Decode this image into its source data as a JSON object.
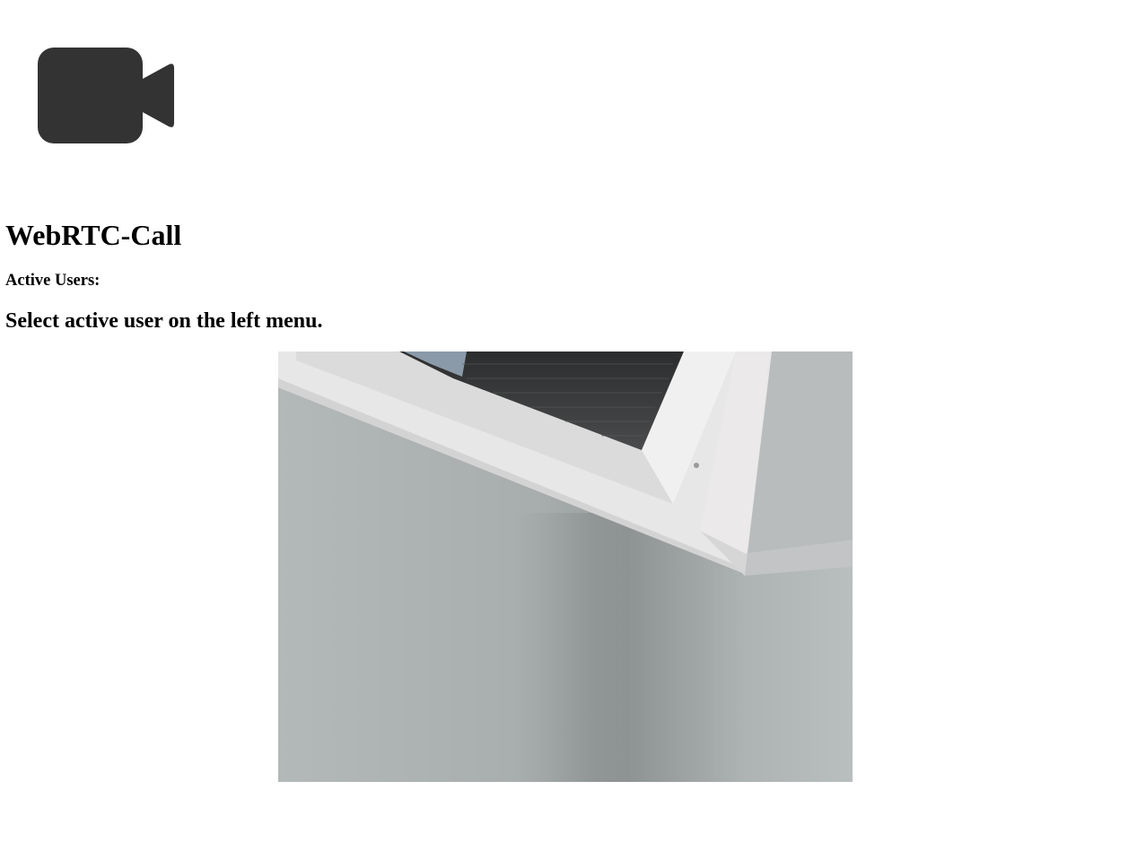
{
  "header": {
    "logo_icon": "video-camera-icon",
    "logo_color": "#333333"
  },
  "main": {
    "title": "WebRTC-Call",
    "active_users_label": "Active Users:",
    "hint": "Select active user on the left menu."
  },
  "video": {
    "content": "local-camera-feed",
    "scene_colors": {
      "wall": "#a9aeae",
      "frame": "#e9e8e9",
      "blind": "#3c3d3d"
    }
  }
}
